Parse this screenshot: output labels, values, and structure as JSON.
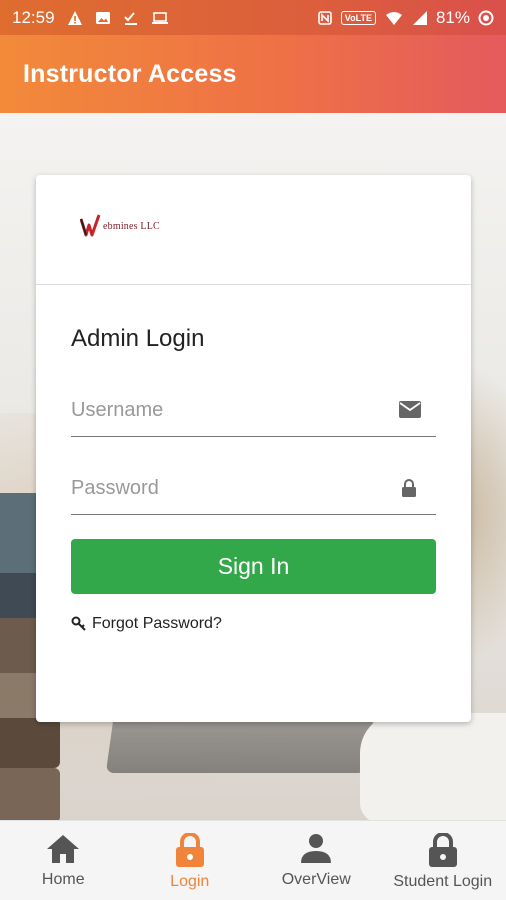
{
  "status_bar": {
    "time": "12:59",
    "volte": "VoLTE",
    "battery": "81%"
  },
  "app_bar": {
    "title": "Instructor Access"
  },
  "logo": {
    "text": "ebmines LLC"
  },
  "login": {
    "heading": "Admin Login",
    "username_placeholder": "Username",
    "password_placeholder": "Password",
    "signin_label": "Sign In",
    "forgot_label": "Forgot Password?"
  },
  "nav": {
    "items": [
      {
        "label": "Home",
        "icon": "home-icon"
      },
      {
        "label": "Login",
        "icon": "lock-icon",
        "active": true
      },
      {
        "label": "OverView",
        "icon": "person-icon"
      },
      {
        "label": "Student Login",
        "icon": "lock-icon"
      }
    ]
  },
  "colors": {
    "accent": "#f0843a",
    "signin_green": "#33a84a",
    "nav_inactive": "#555555"
  }
}
